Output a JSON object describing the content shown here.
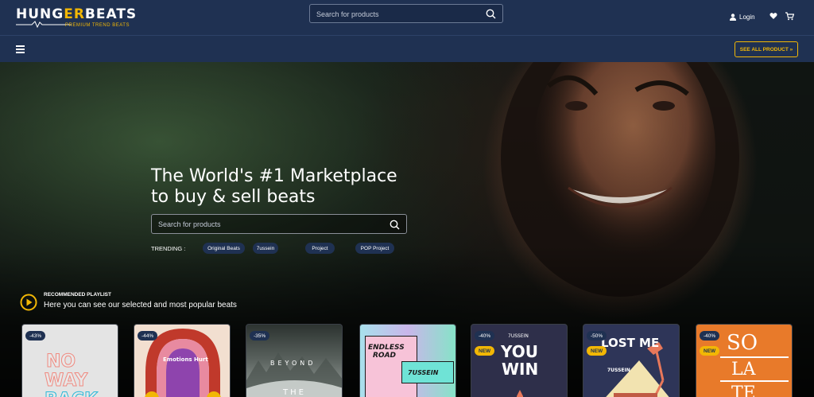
{
  "header": {
    "logo_main": "HUNGERBEATS",
    "logo_main_start": "HUNG",
    "logo_main_accent": "ER",
    "logo_main_end": "BEATS",
    "logo_sub": "PREMIUM TREND BEATS",
    "search_placeholder": "Search for products",
    "login_label": "Login"
  },
  "navbar": {
    "see_all_label": "SEE ALL PRODUCT »"
  },
  "hero": {
    "title_line1": "The World's #1 Marketplace",
    "title_line2": "to buy & sell beats",
    "search_placeholder": "Search for products",
    "trending_label": "TRENDING :",
    "tags": [
      "Original Beats",
      "7ussein",
      "Project",
      "POP Project"
    ]
  },
  "recommended": {
    "label": "RECOMMENDED PLAYLIST",
    "subtitle": "Here you can see our selected and most popular beats"
  },
  "cards": [
    {
      "discount": "-43%",
      "new": "",
      "cover_lines": [
        "NO",
        "WAY",
        "BACK"
      ]
    },
    {
      "discount": "-44%",
      "new": "",
      "cover_lines": [
        "Emotions Hurt"
      ]
    },
    {
      "discount": "-35%",
      "new": "",
      "cover_lines": [
        "BEYOND",
        "THE"
      ]
    },
    {
      "discount": "",
      "new": "",
      "cover_lines": [
        "ENDLESS",
        "ROAD",
        "7USSEIN"
      ]
    },
    {
      "discount": "-40%",
      "new": "NEW",
      "cover_lines": [
        "7USSEIN",
        "YOU",
        "WIN"
      ]
    },
    {
      "discount": "-50%",
      "new": "NEW",
      "cover_lines": [
        "LOST ME",
        "7USSEIN"
      ]
    },
    {
      "discount": "-40%",
      "new": "NEW",
      "cover_lines": [
        "SO",
        "LA",
        "TE"
      ]
    }
  ],
  "colors": {
    "navy": "#1f3152",
    "accent": "#f2b705"
  }
}
